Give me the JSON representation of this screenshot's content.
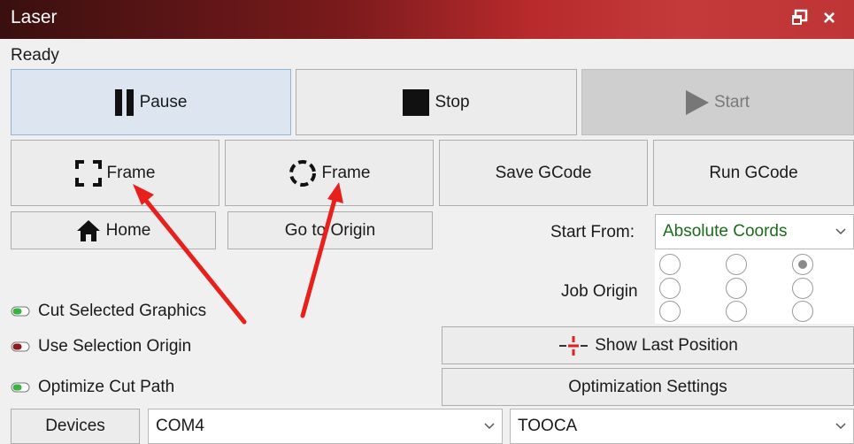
{
  "window": {
    "title": "Laser",
    "float_icon": "float-window-icon",
    "close_icon": "close-icon",
    "close_glyph": "×"
  },
  "status": "Ready",
  "controls": {
    "pause_label": "Pause",
    "stop_label": "Stop",
    "start_label": "Start",
    "frame_rect_label": "Frame",
    "frame_circle_label": "Frame",
    "save_gcode_label": "Save GCode",
    "run_gcode_label": "Run GCode",
    "home_label": "Home",
    "go_to_origin_label": "Go to Origin",
    "show_last_position_label": "Show Last Position",
    "optimization_settings_label": "Optimization Settings",
    "devices_label": "Devices"
  },
  "start_from": {
    "label": "Start From:",
    "value": "Absolute Coords"
  },
  "job_origin": {
    "label": "Job Origin",
    "selected": "top-right"
  },
  "options": {
    "cut_selected_graphics": {
      "label": "Cut Selected Graphics",
      "state": "on"
    },
    "use_selection_origin": {
      "label": "Use Selection Origin",
      "state": "off"
    },
    "optimize_cut_path": {
      "label": "Optimize Cut Path",
      "state": "on"
    }
  },
  "port_select": {
    "value": "COM4"
  },
  "device_select": {
    "value": "TOOCA"
  },
  "colors": {
    "title_bar_dark": "#3a0f0f",
    "title_bar_red": "#c43a3a",
    "toggle_on": "#3cb043",
    "toggle_off": "#8b1a1a",
    "start_from_text": "#1b6b1b",
    "annotation": "#e8201c"
  }
}
